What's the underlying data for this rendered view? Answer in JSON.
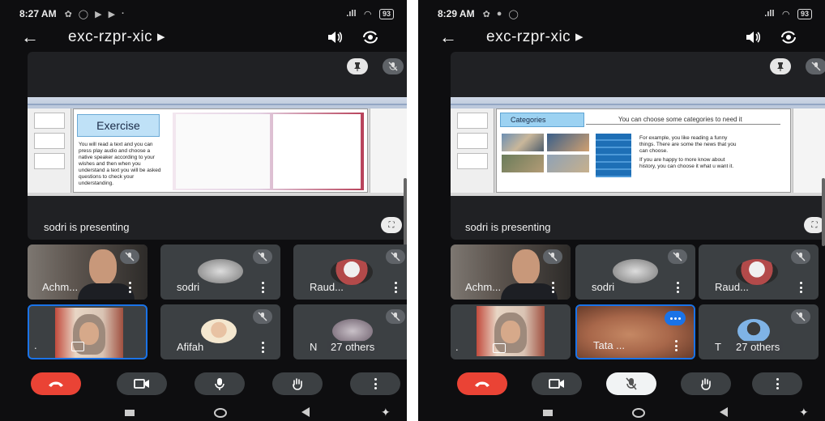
{
  "screens": [
    {
      "status": {
        "time": "8:27 AM",
        "battery": "93"
      },
      "meeting_code": "exc-rzpr-xic",
      "presenting": "sodri is presenting",
      "slide": {
        "heading": "Exercise",
        "body": "You will read a text and you can press play audio and choose a native speaker according to your wishes and then when you understand a text you will be asked questions to check your understanding."
      },
      "tiles": [
        {
          "name": "Achm...",
          "kind": "video-man"
        },
        {
          "name": "sodri",
          "kind": "avatar"
        },
        {
          "name": "Raud...",
          "kind": "avatar"
        },
        {
          "name": "",
          "kind": "self-video"
        },
        {
          "name": "Afifah",
          "kind": "avatar"
        },
        {
          "name": "N",
          "others": "27 others",
          "kind": "others"
        }
      ]
    },
    {
      "status": {
        "time": "8:29 AM",
        "battery": "93"
      },
      "meeting_code": "exc-rzpr-xic",
      "presenting": "sodri is presenting",
      "slide": {
        "heading": "Categories",
        "subheading": "You can choose some categories to need it",
        "bullets": [
          "For example, you like reading a funny things. There are some the news that you can choose.",
          "If you are happy to more know about history, you can choose it what u want it."
        ]
      },
      "tiles": [
        {
          "name": "Achm...",
          "kind": "video-man"
        },
        {
          "name": "sodri",
          "kind": "avatar"
        },
        {
          "name": "Raud...",
          "kind": "avatar"
        },
        {
          "name": "",
          "kind": "self-video"
        },
        {
          "name": "Tata ...",
          "kind": "speaking-video"
        },
        {
          "name": "T",
          "others": "27 others",
          "kind": "others"
        }
      ]
    }
  ],
  "icons": {
    "back": "arrow-left-icon",
    "speaker": "speaker-icon",
    "flip": "flip-camera-icon",
    "pin": "pin-icon",
    "mic_off": "mic-off-icon",
    "fullscreen": "fullscreen-icon",
    "end_call": "end-call-icon",
    "camera": "camera-icon",
    "mic": "mic-icon",
    "raise_hand": "raise-hand-icon",
    "more": "more-vert-icon"
  },
  "colors": {
    "end_call": "#ea4335",
    "active": "#1a73e8",
    "tile": "#3c4043"
  }
}
